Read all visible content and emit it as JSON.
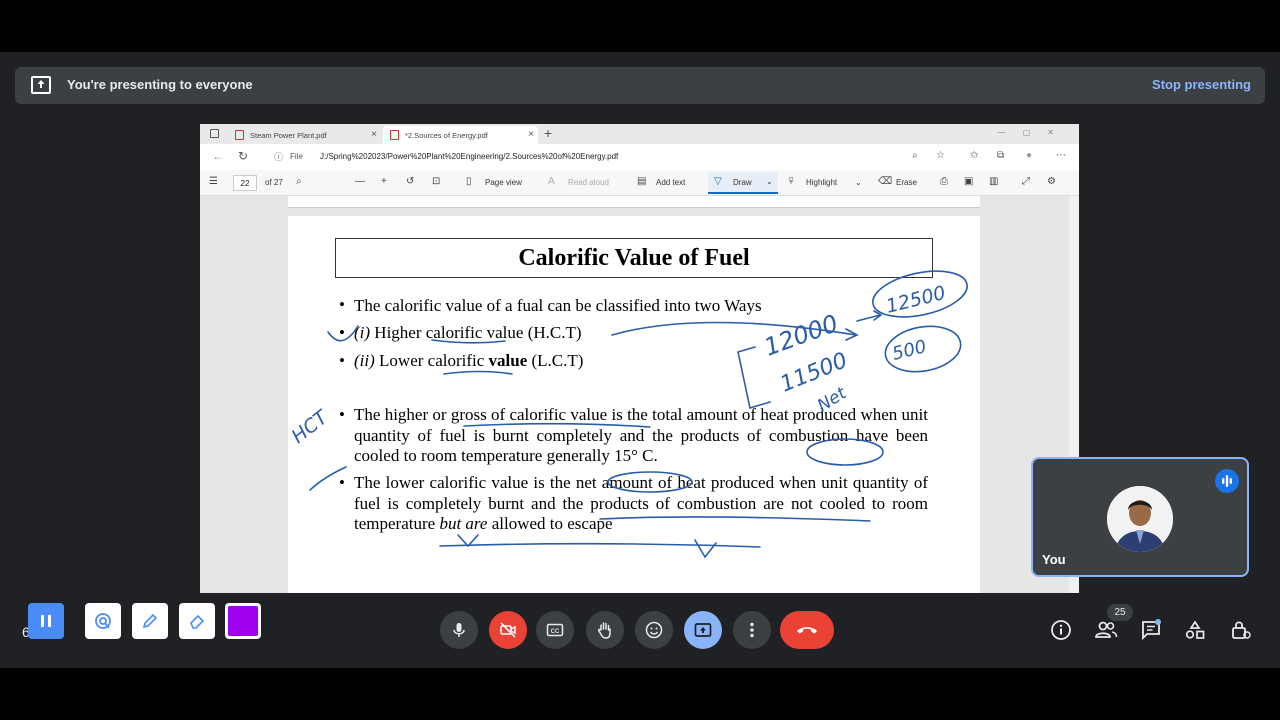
{
  "banner": {
    "text": "You're presenting to everyone",
    "stop_label": "Stop presenting"
  },
  "browser": {
    "tabs": [
      {
        "label": "Steam Power Plant.pdf"
      },
      {
        "label": "*2.Sources of Energy.pdf"
      }
    ],
    "address": {
      "scheme_label": "File",
      "url": "J:/Spring%202023/Power%20Plant%20Engineering/2.Sources%20of%20Energy.pdf"
    },
    "pdf_toolbar": {
      "page_number": "22",
      "page_total": "of 27",
      "page_view": "Page view",
      "read_aloud": "Read aloud",
      "add_text": "Add text",
      "draw": "Draw",
      "highlight": "Highlight",
      "erase": "Erase"
    }
  },
  "slide": {
    "title": "Calorific Value of Fuel",
    "bullet1": "The calorific value of a fual can be classified into two Ways",
    "item1_num": "(i)",
    "item1_text": " Higher calorific value (H.C.T)",
    "item2_num": "(ii)",
    "item2_pre": " Lower calorific ",
    "item2_bold": "value",
    "item2_post": " (L.C.T)",
    "para1": "The higher or gross of calorific value is the total amount of heat produced when unit quantity of fuel is burnt completely and the products of combustion have been cooled to room temperature generally 15° C.",
    "para2_a": "The lower calorific value is the net amount of heat produced when unit quantity of fuel is completely burnt and the products of combustion are not cooled to room temperature ",
    "para2_italic": "but are",
    "para2_b": " allowed to escape"
  },
  "handwriting": {
    "n1": "12000",
    "n2": "12500",
    "n3": "11500",
    "n4": "500",
    "net": "Net",
    "hct": "HCT"
  },
  "self_tile": {
    "name": "You"
  },
  "meeting": {
    "people_count": "25",
    "time_label": "6  M"
  },
  "colors": {
    "ink": "#2a5caa",
    "accent": "#8ab4f8",
    "danger": "#ea4335",
    "pen": "#a000f0"
  }
}
